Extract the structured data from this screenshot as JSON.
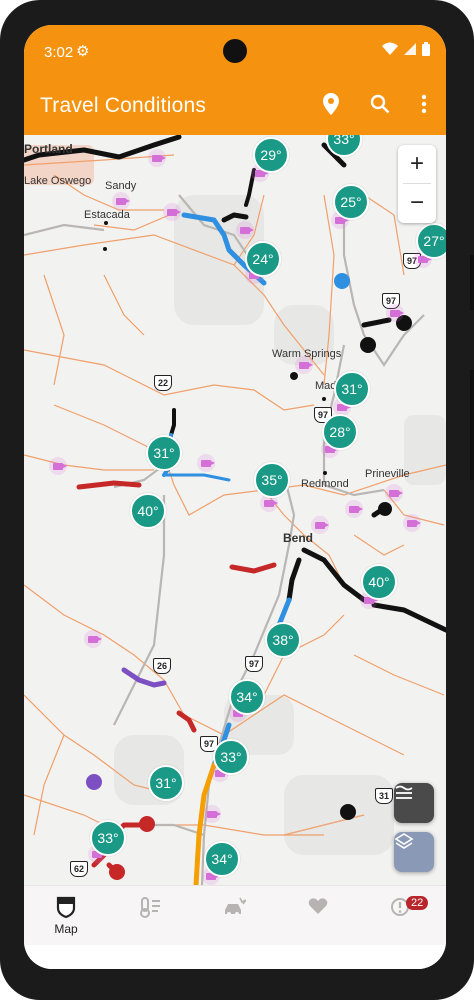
{
  "status_bar": {
    "time": "3:02",
    "icons": [
      "settings-icon",
      "wifi-icon",
      "signal-icon",
      "battery-icon"
    ]
  },
  "app_bar": {
    "title": "Travel Conditions",
    "actions": [
      "location-pin-icon",
      "search-icon",
      "more-vert-icon"
    ]
  },
  "map": {
    "zoom_in_label": "+",
    "zoom_out_label": "−",
    "places": [
      "Portland",
      "Lake Oswego",
      "Sandy",
      "Estacada",
      "Warm Springs",
      "Madras",
      "Redmond",
      "Prineville",
      "Bend"
    ],
    "route_shields": [
      "22",
      "97",
      "97",
      "97",
      "26",
      "97",
      "31",
      "62",
      "97"
    ],
    "temperatures": [
      "33°",
      "29°",
      "25°",
      "27°",
      "24°",
      "31°",
      "28°",
      "31°",
      "35°",
      "40°",
      "40°",
      "38°",
      "34°",
      "33°",
      "31°",
      "33°",
      "34°"
    ],
    "road_colors": {
      "closed": "#111111",
      "restricted": "#c62828",
      "chains": "#7c4fc2",
      "snow": "#2f8fe0",
      "caution": "#f5a000"
    }
  },
  "fabs": {
    "weather_layer": "weather-layer-icon",
    "layers": "layers-icon"
  },
  "bottom_nav": [
    {
      "label": "Map",
      "icon": "map-shield-icon",
      "active": true
    },
    {
      "label": "",
      "icon": "thermometer-icon"
    },
    {
      "label": "",
      "icon": "car-crash-icon"
    },
    {
      "label": "",
      "icon": "heart-icon"
    },
    {
      "label": "",
      "icon": "alert-icon",
      "badge": "22"
    }
  ],
  "colors": {
    "accent": "#f59311",
    "temp_marker": "#1a9a86",
    "camera_marker": "#d46fd8",
    "badge": "#b8262b"
  }
}
